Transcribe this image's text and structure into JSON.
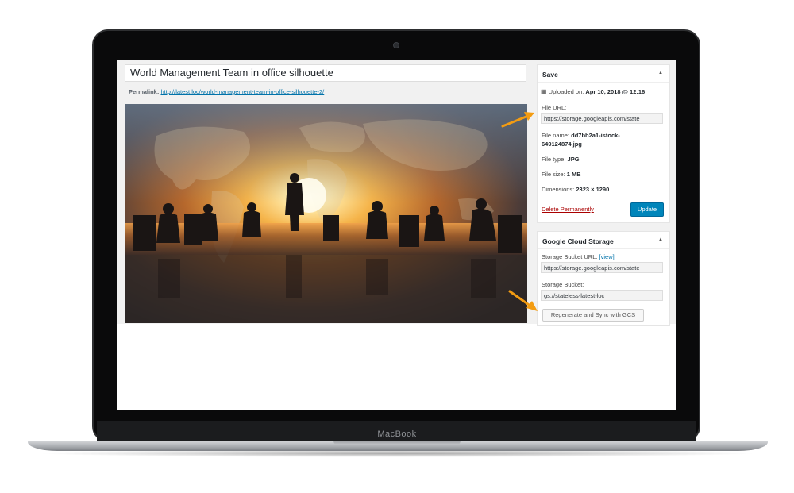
{
  "device": {
    "brand": "MacBook"
  },
  "editor": {
    "title_value": "World Management Team in office silhouette",
    "permalink_label": "Permalink:",
    "permalink_url": "http://latest.loc/world-management-team-in-office-silhouette-2/"
  },
  "save_box": {
    "heading": "Save",
    "uploaded_label": "Uploaded on:",
    "uploaded_value": "Apr 10, 2018 @ 12:16",
    "file_url_label": "File URL:",
    "file_url_value": "https://storage.googleapis.com/state",
    "file_name_label": "File name:",
    "file_name_line1": "dd7bb2a1-istock-",
    "file_name_line2": "649124874.jpg",
    "file_type_label": "File type:",
    "file_type_value": "JPG",
    "file_size_label": "File size:",
    "file_size_value": "1 MB",
    "dimensions_label": "Dimensions:",
    "dimensions_value": "2323 × 1290",
    "delete_label": "Delete Permanently",
    "update_label": "Update"
  },
  "gcs_box": {
    "heading": "Google Cloud Storage",
    "bucket_url_label": "Storage Bucket URL:",
    "view_link": "[view]",
    "bucket_url_value": "https://storage.googleapis.com/state",
    "bucket_label": "Storage Bucket:",
    "bucket_value": "gs://stateless-latest-loc",
    "regen_label": "Regenerate and Sync with GCS"
  },
  "colors": {
    "primary_button": "#0085ba",
    "link": "#0073aa",
    "delete": "#aa0000",
    "annotation_arrow": "#f39c12"
  }
}
